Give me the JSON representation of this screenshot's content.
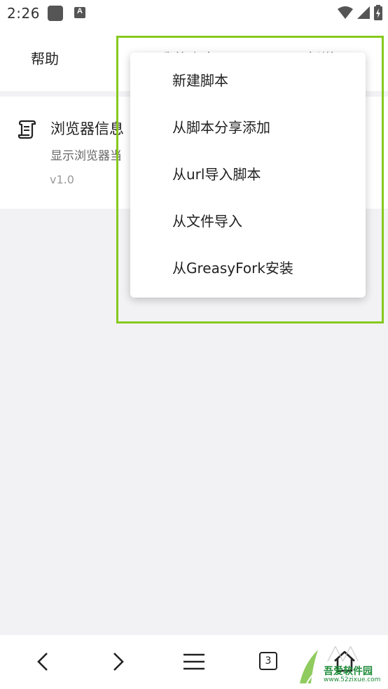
{
  "status_bar": {
    "time": "2:26",
    "icons": [
      "app-icon",
      "a-icon",
      "wifi-icon",
      "signal-icon",
      "battery-icon"
    ]
  },
  "tabs": {
    "help": "帮助",
    "mine": "我的脚本",
    "new": "新增"
  },
  "script": {
    "name": "浏览器信息",
    "description": "显示浏览器当",
    "version": "v1.0",
    "icon": "scroll-icon"
  },
  "menu": {
    "items": [
      "新建脚本",
      "从脚本分享添加",
      "从url导入脚本",
      "从文件导入",
      "从GreasyFork安装"
    ]
  },
  "bottom_nav": {
    "tab_count": "3",
    "icons": [
      "back-icon",
      "forward-icon",
      "menu-icon",
      "tabs-icon",
      "home-icon"
    ]
  },
  "watermark": {
    "text": "吾爱软件园",
    "url": "www.52zixue.com"
  },
  "colors": {
    "highlight": "#86c91e",
    "background": "#f2f2f4"
  }
}
